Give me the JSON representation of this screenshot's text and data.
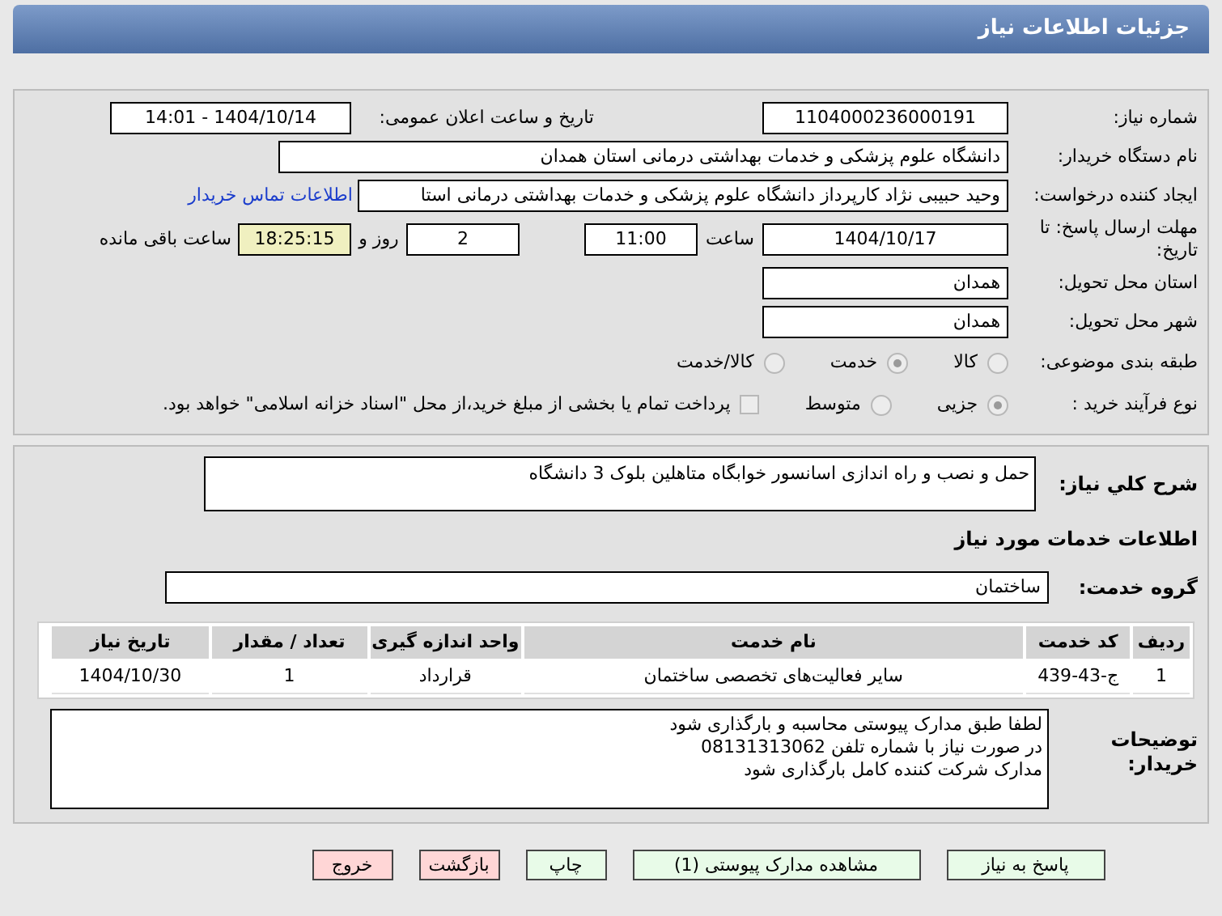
{
  "header": {
    "title": "جزئیات اطلاعات نیاز"
  },
  "need_number": {
    "label": "شماره نیاز:",
    "value": "1104000236000191"
  },
  "announce": {
    "label": "تاریخ و ساعت اعلان عمومی:",
    "value": "1404/10/14 - 14:01"
  },
  "buyer": {
    "label": "نام دستگاه خریدار:",
    "value": "دانشگاه علوم پزشکی و خدمات بهداشتی درمانی استان همدان"
  },
  "creator": {
    "label": "ایجاد کننده درخواست:",
    "value": "وحید حبیبی نژاد کارپرداز دانشگاه علوم پزشکی و خدمات بهداشتی درمانی استا",
    "link": "اطلاعات تماس خریدار"
  },
  "deadline": {
    "label": "مهلت ارسال پاسخ: تا تاریخ:",
    "date": "1404/10/17",
    "time_label": "ساعت",
    "time": "11:00",
    "days": "2",
    "days_label": "روز و",
    "remaining": "18:25:15",
    "remaining_label": "ساعت باقی مانده"
  },
  "province": {
    "label": "استان محل تحویل:",
    "value": "همدان"
  },
  "city": {
    "label": "شهر محل تحویل:",
    "value": "همدان"
  },
  "category": {
    "label": "طبقه بندی موضوعی:",
    "options": [
      {
        "label": "کالا",
        "selected": false
      },
      {
        "label": "خدمت",
        "selected": true
      },
      {
        "label": "کالا/خدمت",
        "selected": false
      }
    ]
  },
  "process": {
    "label": "نوع فرآیند خرید :",
    "options": [
      {
        "label": "جزیی",
        "selected": true
      },
      {
        "label": "متوسط",
        "selected": false
      }
    ],
    "payment": {
      "label": "پرداخت تمام یا بخشی از مبلغ خرید،از محل \"اسناد خزانه اسلامی\" خواهد بود.",
      "checked": false
    }
  },
  "description": {
    "label": "شرح كلي نياز:",
    "value": "حمل و نصب و راه اندازی اسانسور خوابگاه متاهلین بلوک 3 دانشگاه"
  },
  "services_heading": "اطلاعات خدمات مورد نیاز",
  "service_group": {
    "label": "گروه خدمت:",
    "value": "ساختمان"
  },
  "table": {
    "columns": [
      "ردیف",
      "کد خدمت",
      "نام خدمت",
      "واحد اندازه گیری",
      "تعداد / مقدار",
      "تاریخ نیاز"
    ],
    "rows": [
      [
        "1",
        "ج-43-439",
        "سایر فعالیت‌های تخصصی ساختمان",
        "قرارداد",
        "1",
        "1404/10/30"
      ]
    ]
  },
  "notes": {
    "label": "توضیحات خریدار:",
    "lines": [
      "لطفا طبق مدارک پیوستی محاسبه و بارگذاری شود",
      "در صورت نیاز با شماره تلفن 08131313062",
      "مدارک شرکت کننده کامل بارگذاری شود"
    ]
  },
  "buttons": [
    {
      "label": "پاسخ به نیاز",
      "kind": "primary"
    },
    {
      "label": "مشاهده مدارک پیوستی (1)",
      "kind": "primary"
    },
    {
      "label": "چاپ",
      "kind": "primary"
    },
    {
      "label": "بازگشت",
      "kind": "danger"
    },
    {
      "label": "خروج",
      "kind": "danger"
    }
  ]
}
